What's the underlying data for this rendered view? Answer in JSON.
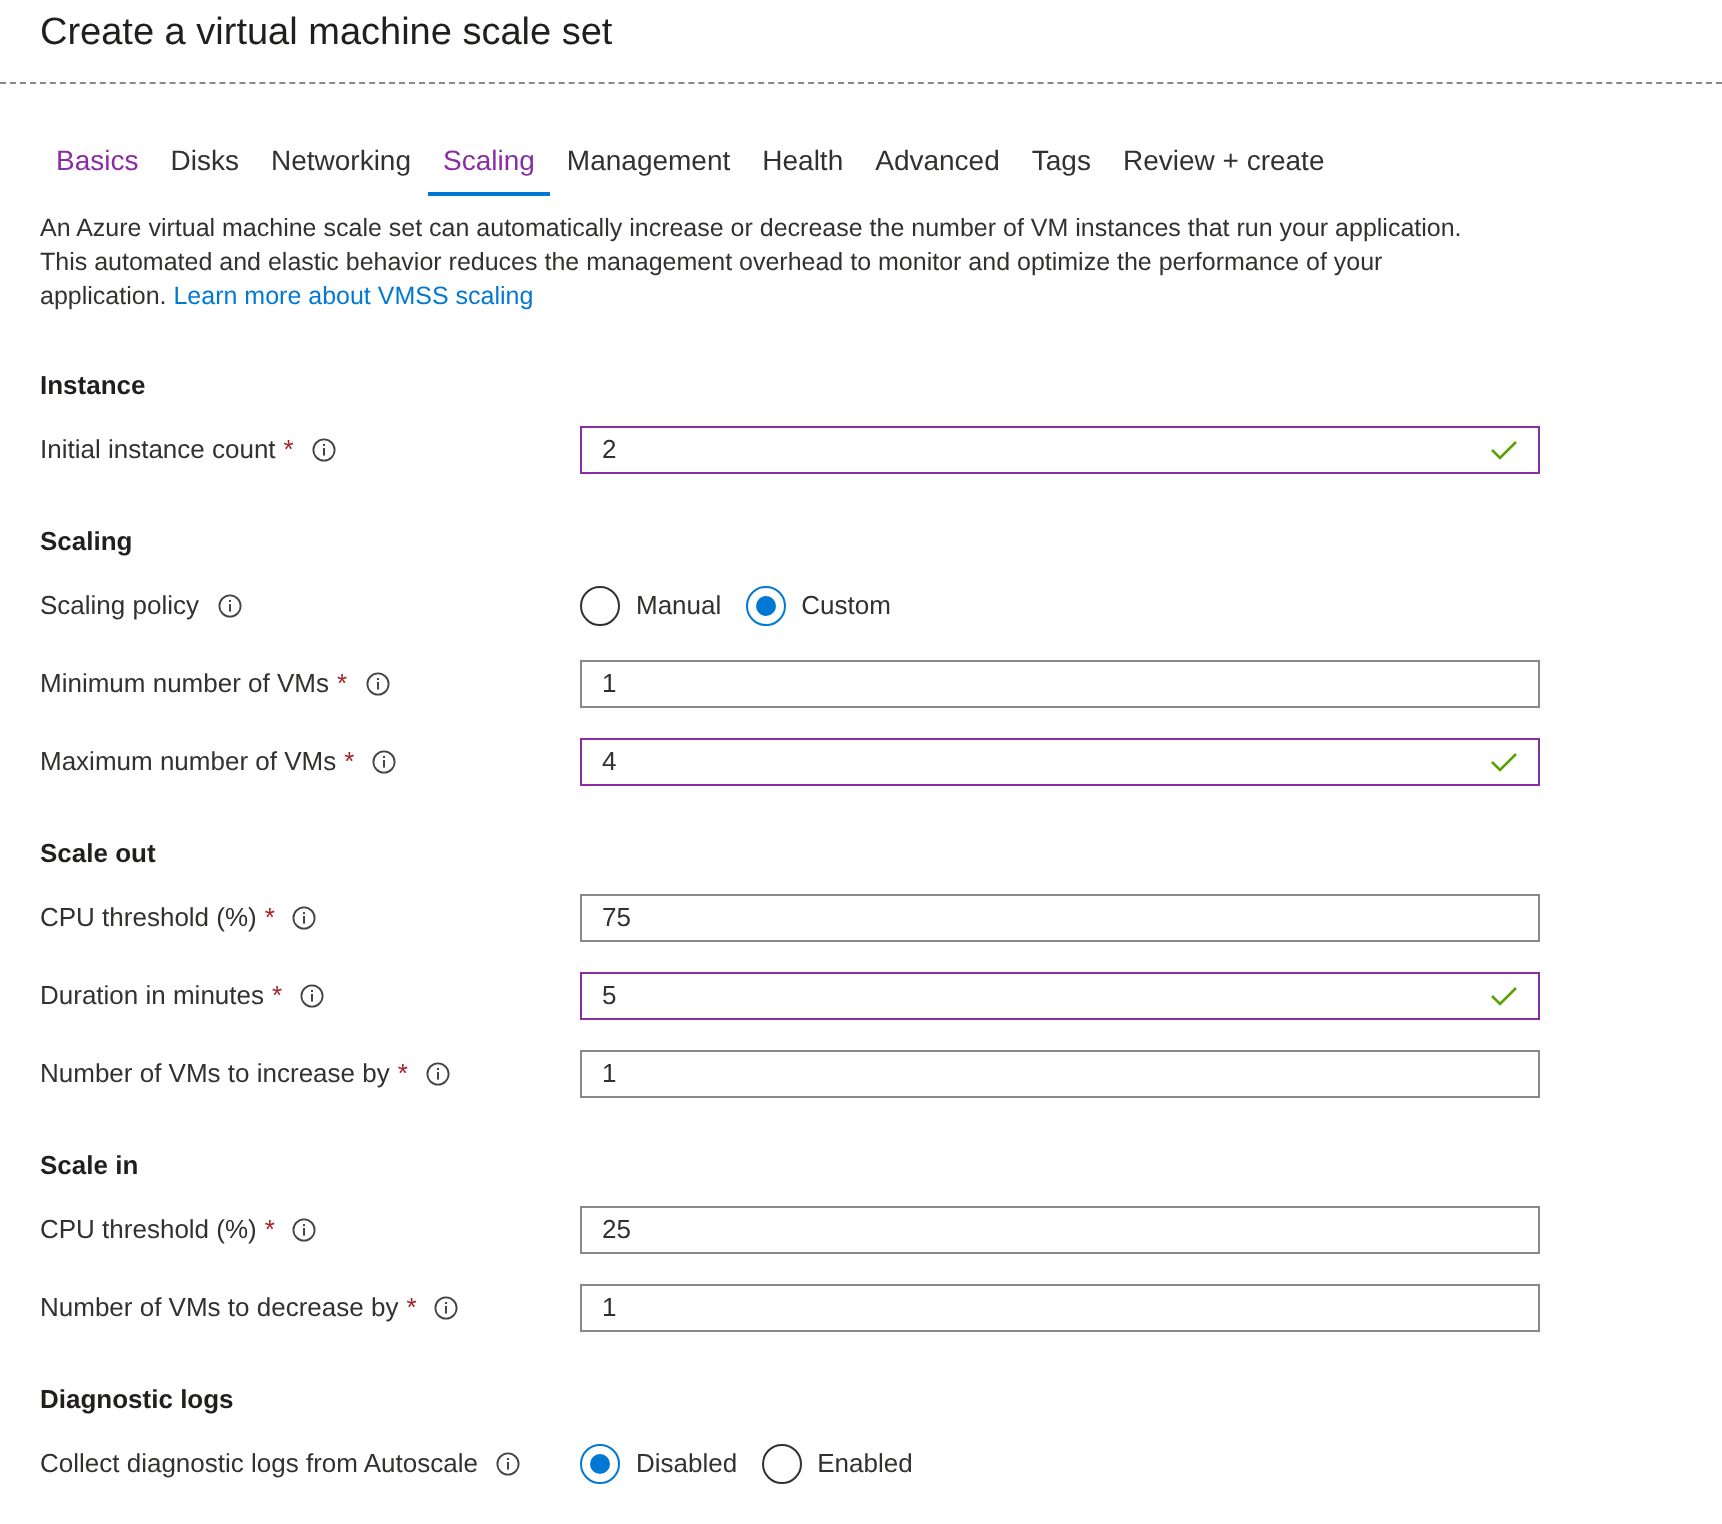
{
  "title": "Create a virtual machine scale set",
  "tabs": [
    {
      "label": "Basics",
      "selected": false,
      "visited": true
    },
    {
      "label": "Disks",
      "selected": false,
      "visited": false
    },
    {
      "label": "Networking",
      "selected": false,
      "visited": false
    },
    {
      "label": "Scaling",
      "selected": true,
      "visited": true
    },
    {
      "label": "Management",
      "selected": false,
      "visited": false
    },
    {
      "label": "Health",
      "selected": false,
      "visited": false
    },
    {
      "label": "Advanced",
      "selected": false,
      "visited": false
    },
    {
      "label": "Tags",
      "selected": false,
      "visited": false
    },
    {
      "label": "Review + create",
      "selected": false,
      "visited": false
    }
  ],
  "intro": {
    "text": "An Azure virtual machine scale set can automatically increase or decrease the number of VM instances that run your application. This automated and elastic behavior reduces the management overhead to monitor and optimize the performance of your application.",
    "link": "Learn more about VMSS scaling"
  },
  "sections": [
    {
      "heading": "Instance",
      "rows": [
        {
          "kind": "field",
          "label": "Initial instance count",
          "required": "*",
          "value": "2",
          "valid": true
        }
      ]
    },
    {
      "heading": "Scaling",
      "rows": [
        {
          "kind": "radio",
          "label": "Scaling policy",
          "options": [
            {
              "label": "Manual",
              "selected": false
            },
            {
              "label": "Custom",
              "selected": true
            }
          ]
        },
        {
          "kind": "field",
          "label": "Minimum number of VMs",
          "required": "*",
          "value": "1",
          "valid": false
        },
        {
          "kind": "field",
          "label": "Maximum number of VMs",
          "required": "*",
          "value": "4",
          "valid": true
        }
      ]
    },
    {
      "heading": "Scale out",
      "rows": [
        {
          "kind": "field",
          "label": "CPU threshold (%)",
          "required": "*",
          "value": "75",
          "valid": false
        },
        {
          "kind": "field",
          "label": "Duration in minutes",
          "required": "*",
          "value": "5",
          "valid": true
        },
        {
          "kind": "field",
          "label": "Number of VMs to increase by",
          "required": "*",
          "value": "1",
          "valid": false
        }
      ]
    },
    {
      "heading": "Scale in",
      "rows": [
        {
          "kind": "field",
          "label": "CPU threshold (%)",
          "required": "*",
          "value": "25",
          "valid": false
        },
        {
          "kind": "field",
          "label": "Number of VMs to decrease by",
          "required": "*",
          "value": "1",
          "valid": false
        }
      ]
    },
    {
      "heading": "Diagnostic logs",
      "rows": [
        {
          "kind": "radio",
          "label": "Collect diagnostic logs from Autoscale",
          "options": [
            {
              "label": "Disabled",
              "selected": true
            },
            {
              "label": "Enabled",
              "selected": false
            }
          ]
        }
      ]
    }
  ]
}
